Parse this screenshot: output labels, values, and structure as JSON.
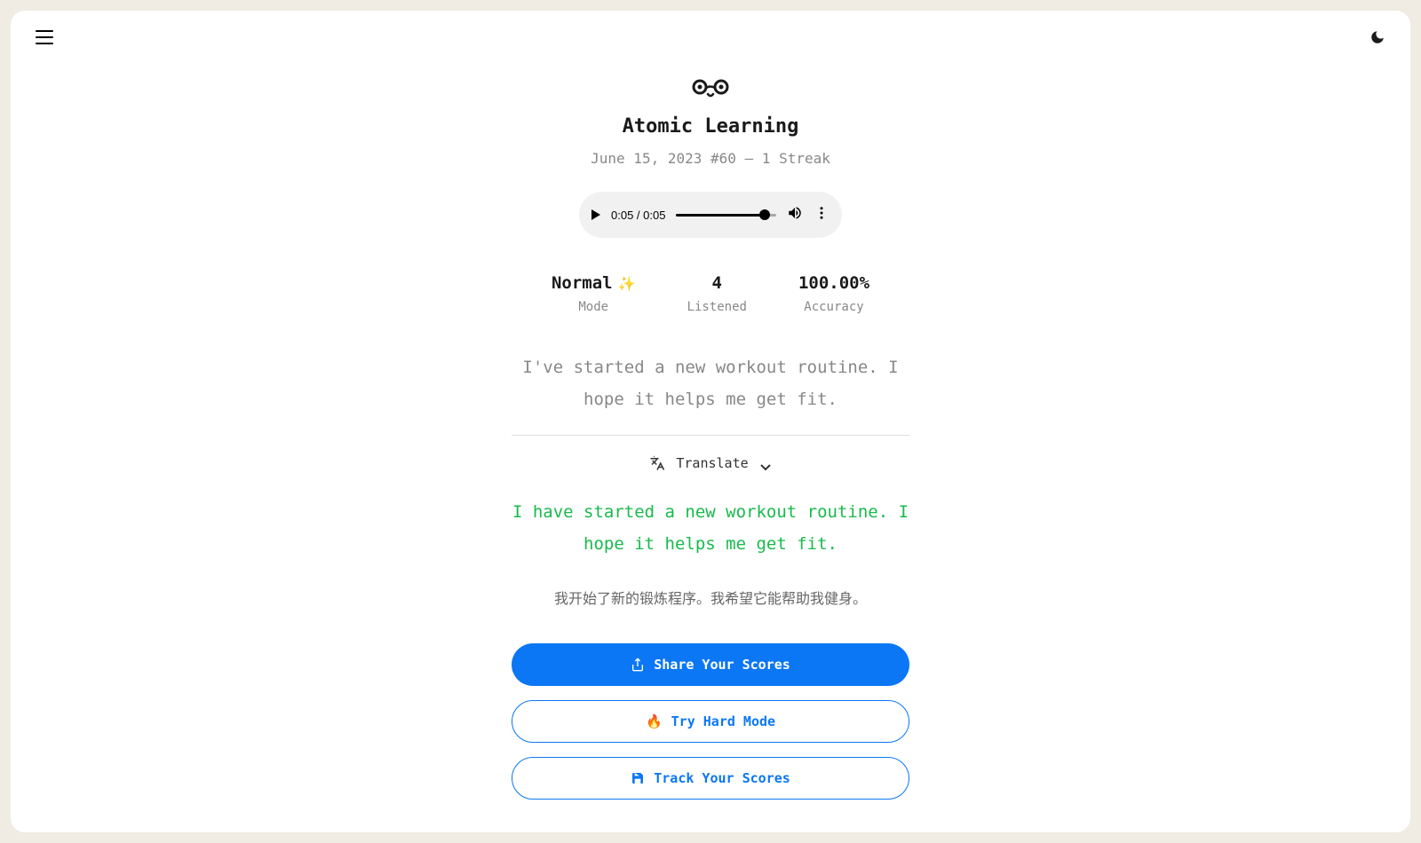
{
  "header": {
    "title": "Atomic Learning",
    "subtitle": "June 15, 2023 #60 — 1 Streak"
  },
  "audio": {
    "time": "0:05 / 0:05"
  },
  "stats": {
    "mode": {
      "value": "Normal",
      "label": "Mode",
      "sparkle": "✨"
    },
    "listened": {
      "value": "4",
      "label": "Listened"
    },
    "accuracy": {
      "value": "100.00%",
      "label": "Accuracy"
    }
  },
  "sentences": {
    "original": "I've started a new workout routine. I hope it helps me get fit.",
    "highlighted": "I have started a new workout routine. I hope it helps me get fit.",
    "translated": "我开始了新的锻炼程序。我希望它能帮助我健身。"
  },
  "translate": {
    "label": "Translate"
  },
  "buttons": {
    "share": "Share Your Scores",
    "hardmode": "Try Hard Mode",
    "track": "Track Your Scores",
    "fire": "🔥"
  }
}
